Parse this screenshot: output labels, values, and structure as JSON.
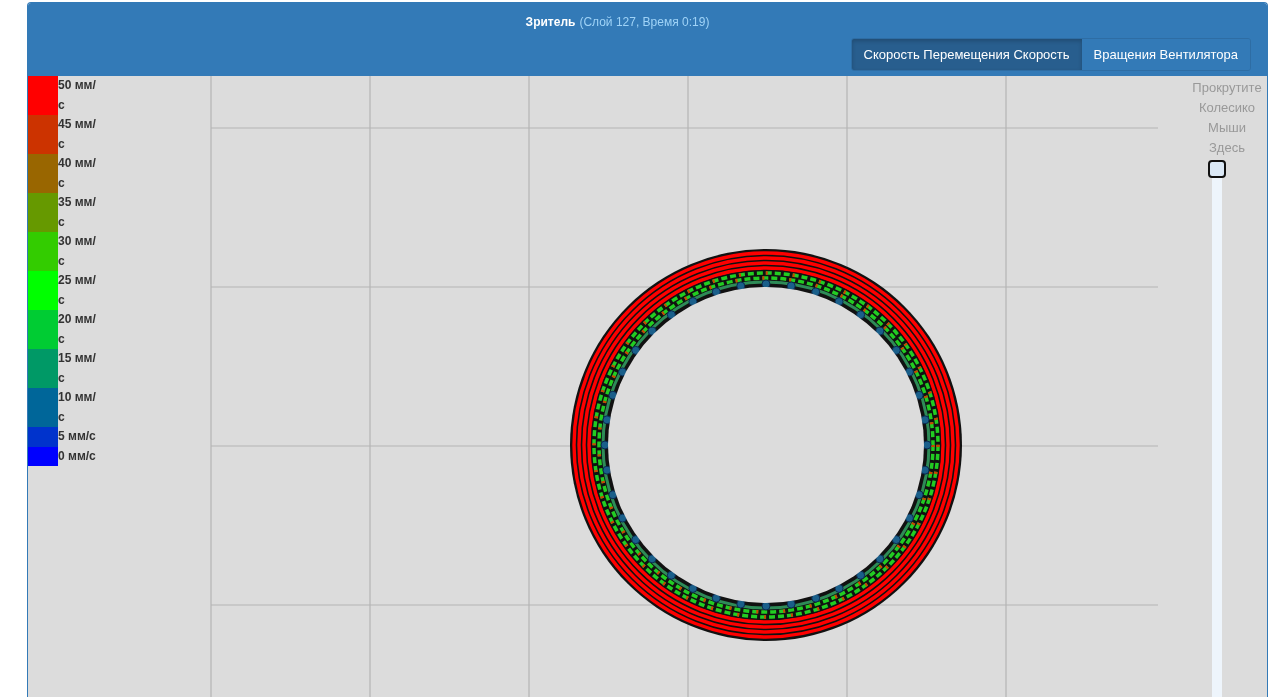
{
  "viewer": {
    "title": "Зритель",
    "info": "(Слой 127, Время 0:19)"
  },
  "view_modes": [
    {
      "label": "Скорость Перемещения Скорость",
      "selected": true
    },
    {
      "label": "Вращения Вентилятора",
      "selected": false
    }
  ],
  "legend": [
    {
      "label": "50 мм/с",
      "color": "#ff0000"
    },
    {
      "label": "45 мм/с",
      "color": "#cc3300"
    },
    {
      "label": "40 мм/с",
      "color": "#996600"
    },
    {
      "label": "35 мм/с",
      "color": "#669900"
    },
    {
      "label": "30 мм/с",
      "color": "#33cc00"
    },
    {
      "label": "25 мм/с",
      "color": "#00ff00"
    },
    {
      "label": "20 мм/с",
      "color": "#00cc33"
    },
    {
      "label": "15 мм/с",
      "color": "#009966"
    },
    {
      "label": "10 мм/с",
      "color": "#006699"
    },
    {
      "label": "5 мм/с",
      "color": "#0033cc"
    },
    {
      "label": "0 мм/с",
      "color": "#0000ff"
    }
  ],
  "layer_slider": {
    "hint": "Прокрутите Колесико Мыши Здесь",
    "level": 1
  }
}
